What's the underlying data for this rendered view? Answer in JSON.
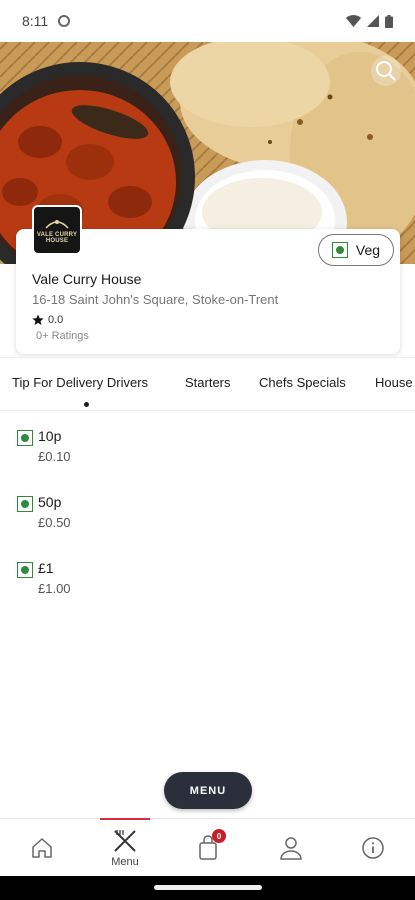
{
  "status_bar": {
    "time": "8:11"
  },
  "restaurant": {
    "logo_text": "VALE CURRY HOUSE",
    "name": "Vale Curry House",
    "address": "16-18 Saint John's Square, Stoke-on-Trent",
    "rating": "0.0",
    "ratings_count": "0+ Ratings"
  },
  "veg_filter": {
    "label": "Veg"
  },
  "tabs": [
    {
      "label": "Tip For Delivery Drivers",
      "active": true
    },
    {
      "label": "Starters"
    },
    {
      "label": "Chefs Specials"
    },
    {
      "label": "House"
    }
  ],
  "items": [
    {
      "name": "10p",
      "price": "£0.10"
    },
    {
      "name": "50p",
      "price": "£0.50"
    },
    {
      "name": "£1",
      "price": "£1.00"
    }
  ],
  "menu_button": {
    "label": "MENU"
  },
  "bottom_nav": {
    "items": [
      {
        "icon": "home-icon"
      },
      {
        "icon": "menu-cutlery-icon",
        "label": "Menu",
        "active": true
      },
      {
        "icon": "cart-icon",
        "badge": "0"
      },
      {
        "icon": "profile-icon"
      },
      {
        "icon": "info-icon"
      }
    ]
  },
  "colors": {
    "accent": "#d62e3a",
    "veg_green": "#2e8b3d",
    "menu_button": "#2b2f3b"
  }
}
